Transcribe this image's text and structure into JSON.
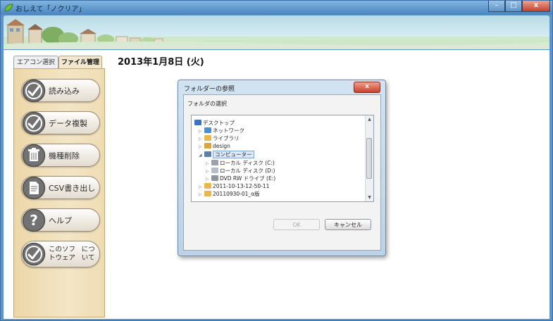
{
  "window": {
    "title": "おしえて「ノクリア」",
    "controls": {
      "minimize": "–",
      "maximize": "□",
      "close": "x"
    }
  },
  "tabs": [
    {
      "label": "エアコン選択",
      "active": false
    },
    {
      "label": "ファイル管理",
      "active": true
    }
  ],
  "sidebar": {
    "buttons": [
      {
        "label": "読み込み",
        "icon": "check-icon"
      },
      {
        "label": "データ複製",
        "icon": "check-icon"
      },
      {
        "label": "機種削除",
        "icon": "trash-icon"
      },
      {
        "label": "CSV書き出し",
        "icon": "document-icon"
      },
      {
        "label": "ヘルプ",
        "icon": "question-icon"
      },
      {
        "label": "このソフトウェアについて",
        "label_line1": "このソフトウェア",
        "label_line2": "について",
        "icon": "check-icon"
      }
    ]
  },
  "main": {
    "date": "2013年1月8日 (火)"
  },
  "dialog": {
    "title": "フォルダーの参照",
    "close": "x",
    "instruction": "フォルダの選択",
    "tree": [
      {
        "label": "デスクトップ",
        "icon": "desktop-icon",
        "expander": "",
        "level": 0
      },
      {
        "label": "ネットワーク",
        "icon": "network-icon",
        "expander": "▷",
        "level": 1
      },
      {
        "label": "ライブラリ",
        "icon": "library-icon",
        "expander": "▷",
        "level": 1
      },
      {
        "label": "design",
        "icon": "user-folder-icon",
        "expander": "▷",
        "level": 1
      },
      {
        "label": "コンピューター",
        "icon": "computer-icon",
        "expander": "◢",
        "level": 1,
        "selected": true
      },
      {
        "label": "ローカル ディスク (C:)",
        "icon": "drive-icon",
        "expander": "▷",
        "level": 2
      },
      {
        "label": "ローカル ディスク (D:)",
        "icon": "drive-icon",
        "expander": "▷",
        "level": 2
      },
      {
        "label": "DVD RW ドライブ (E:)",
        "icon": "dvd-icon",
        "expander": "▷",
        "level": 2
      },
      {
        "label": "2011-10-13-12-50-11",
        "icon": "folder-icon",
        "expander": "▷",
        "level": 1
      },
      {
        "label": "20110930-01_α版",
        "icon": "folder-icon",
        "expander": "▷",
        "level": 1
      }
    ],
    "scroll_up": "▲",
    "scroll_down": "▼",
    "ok_label": "OK",
    "cancel_label": "キャンセル"
  },
  "colors": {
    "titlebar": "#5b95c9",
    "panel": "#f0e0b9",
    "accent_icon": "#6e6e6e",
    "folder": "#e8b84a"
  }
}
